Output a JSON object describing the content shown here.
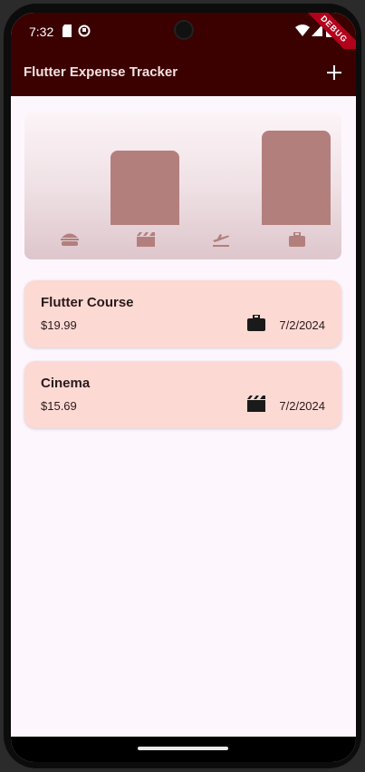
{
  "status_bar": {
    "time": "7:32",
    "debug_label": "DEBUG",
    "icons": [
      "sd-card-icon",
      "sync-icon",
      "wifi-icon",
      "signal-icon",
      "battery-icon"
    ]
  },
  "app_bar": {
    "title": "Flutter Expense Tracker",
    "add_icon": "plus-icon",
    "add_label": "+"
  },
  "colors": {
    "app_bar_bg": "#3b0000",
    "card_bg": "#fdd9d4",
    "bar_fill": "#b37f7d",
    "icon_muted": "#b37f7d"
  },
  "chart_data": {
    "type": "bar",
    "categories": [
      "food",
      "leisure",
      "travel",
      "work"
    ],
    "category_icons": [
      "burger-icon",
      "movie-clapper-icon",
      "flight-takeoff-icon",
      "work-briefcase-icon"
    ],
    "values": [
      0,
      15.69,
      0,
      19.99
    ],
    "title": "",
    "xlabel": "",
    "ylabel": "",
    "ylim": [
      0,
      19.99
    ]
  },
  "expenses": [
    {
      "title": "Flutter Course",
      "amount": "$19.99",
      "category_icon": "work-briefcase-icon",
      "date": "7/2/2024"
    },
    {
      "title": "Cinema",
      "amount": "$15.69",
      "category_icon": "movie-clapper-icon",
      "date": "7/2/2024"
    }
  ]
}
